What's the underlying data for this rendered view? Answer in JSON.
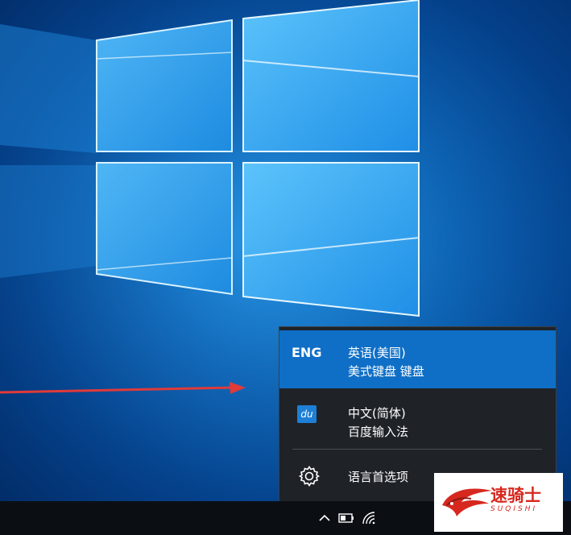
{
  "language_flyout": {
    "items": [
      {
        "code": "ENG",
        "name": "英语(美国)",
        "keyboard": "美式键盘 键盘",
        "selected": true
      },
      {
        "icon": "baidu-ime-icon",
        "icon_text": "du",
        "name": "中文(简体)",
        "keyboard": "百度输入法",
        "selected": false
      }
    ],
    "preferences_label": "语言首选项",
    "preferences_icon": "gear-icon"
  },
  "taskbar": {
    "tray_icons": [
      "chevron-up-icon",
      "battery-icon",
      "wifi-icon"
    ]
  },
  "watermark": {
    "text": "速骑士",
    "sub": "SUQISHI"
  },
  "colors": {
    "selected_bg": "#0f6fc6",
    "flyout_bg": "#1f2328",
    "taskbar_bg": "#0b0f14",
    "arrow": "#e03a3a"
  }
}
